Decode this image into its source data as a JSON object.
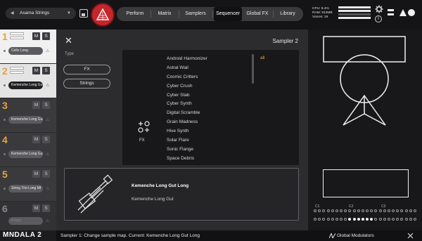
{
  "topbar": {
    "preset_name": "Asama Strings",
    "tabs": [
      "Perform",
      "Matrix",
      "Samplers",
      "Sequencer",
      "Global FX",
      "Library"
    ],
    "active_tab": "Sequencer",
    "stats": {
      "cpu": "CPU: 8.4%",
      "ram": "RAM: 913MB",
      "voices": "Voices: 19"
    }
  },
  "samplers": [
    {
      "number": "1",
      "name": "Cello Long"
    },
    {
      "number": "2",
      "name": "Kemenche Long Gut"
    },
    {
      "number": "3",
      "name": "Kemenche Long Gut"
    },
    {
      "number": "4",
      "name": "Kemenche Long Gut"
    },
    {
      "number": "5",
      "name": "String Trio Long Mf"
    },
    {
      "number": "6",
      "name": "Empty"
    }
  ],
  "slot_buttons": {
    "mute": "M",
    "solo": "S"
  },
  "brand": "MNDALA 2",
  "panel": {
    "title": "Sampler 2",
    "type_label": "Type",
    "type_options": [
      "FX",
      "Strings"
    ],
    "fx_label": "FX",
    "filter_tag": "all",
    "browser_items": [
      "Android Harmonizer",
      "Astral Wail",
      "Cosmic Critters",
      "Cyber Crush",
      "Cyber Stab",
      "Cyber Synth",
      "Digital Scramble",
      "Grain Madness",
      "Hive Synth",
      "Solar Flare",
      "Sonic Flange",
      "Space Debris"
    ],
    "selected_instrument": "Kemenche Long Gut Long",
    "selected_instrument_sub": "Kemenche Long Gut"
  },
  "keyboard": {
    "octaves": [
      "C1",
      "C2",
      "C3"
    ]
  },
  "status": {
    "message": "Sampler 1: Change sample map. Current: Kemenche Long Gut Long",
    "global_modulators": "Global Modulators"
  }
}
